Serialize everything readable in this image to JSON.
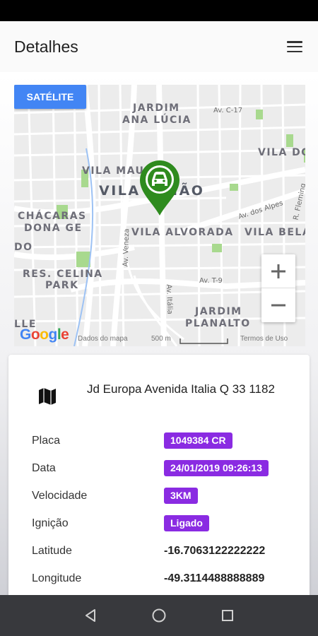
{
  "app_bar": {
    "title": "Detalhes",
    "menu_icon": "menu-icon"
  },
  "map": {
    "satellite_label": "SATÉLITE",
    "zoom_in_icon": "plus-icon",
    "zoom_out_icon": "minus-icon",
    "logo_text": "Google",
    "attribution": "Dados do mapa",
    "scale": "500 m",
    "terms": "Termos de Uso",
    "marker_icon": "car-marker-icon",
    "neighborhoods": {
      "jardim_ana_lucia_1": "JARDIM",
      "jardim_ana_lucia_2": "ANA LÚCIA",
      "vila_do": "VILA DO",
      "vila_maua": "VILA MAUÁ",
      "vila_uniao": "VILA UNIÃO",
      "chacaras_1": "CHÁCARAS",
      "chacaras_2": "DONA GE",
      "do": "DO",
      "vila_alvorada": "VILA ALVORADA",
      "vila_bela": "VILA BELA",
      "res_celina_1": "RES. CELINA",
      "res_celina_2": "PARK",
      "jardim_planalto_1": "JARDIM",
      "jardim_planalto_2": "PLANALTO",
      "lle": "LLE"
    },
    "streets": {
      "c17": "Av. C-17",
      "alpes": "Av. dos Alpes",
      "fleming": "R. Fleming",
      "veneza": "Av. Veneza",
      "t9": "Av. T-9",
      "italia": "Av. Itália"
    }
  },
  "details": {
    "address_icon": "map-icon",
    "address": "Jd Europa Avenida Italia Q 33 1182",
    "placa_label": "Placa",
    "placa_value": "1049384 CR",
    "data_label": "Data",
    "data_value": "24/01/2019 09:26:13",
    "velocidade_label": "Velocidade",
    "velocidade_value": "3KM",
    "ignicao_label": "Ignição",
    "ignicao_value": "Ligado",
    "latitude_label": "Latitude",
    "latitude_value": "-16.7063122222222",
    "longitude_label": "Longitude",
    "longitude_value": "-49.3114488888889"
  },
  "nav": {
    "back_icon": "back-triangle-icon",
    "home_icon": "home-circle-icon",
    "recents_icon": "recents-square-icon"
  },
  "colors": {
    "accent": "#4285f4",
    "badge": "#8a2be2",
    "marker": "#2e8b1e"
  }
}
